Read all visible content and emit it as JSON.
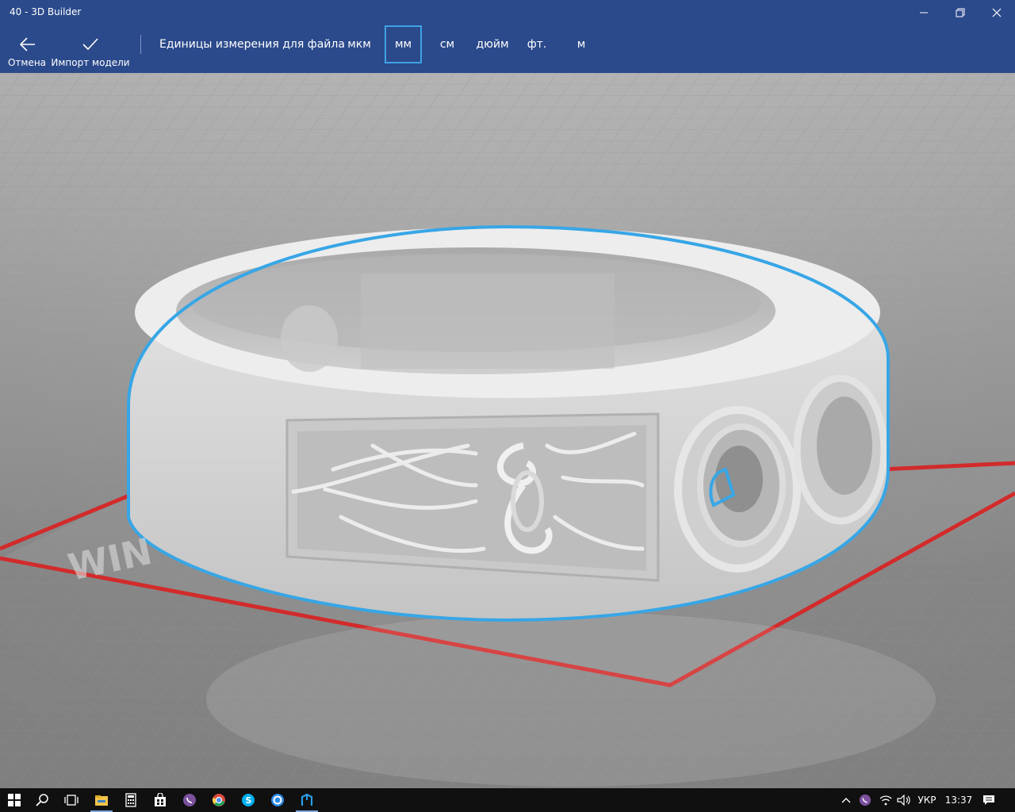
{
  "window": {
    "title": "40 - 3D Builder"
  },
  "commandbar": {
    "cancel_label": "Отмена",
    "import_label": "Импорт модели",
    "units_label": "Единицы измерения для файла",
    "units": [
      "мкм",
      "мм",
      "см",
      "дюйм",
      "фт.",
      "м"
    ],
    "selected_unit": "мм"
  },
  "viewport": {
    "selection_color": "#37a6e6",
    "plate_border_color": "#d22b2b"
  },
  "taskbar": {
    "language": "УКР",
    "time": "13:37",
    "apps": [
      "start-icon",
      "search-icon",
      "task-view-icon",
      "file-explorer-icon",
      "calculator-icon",
      "store-icon",
      "viber-icon",
      "chrome-icon",
      "skype-icon",
      "settings-app-icon",
      "3d-builder-icon"
    ]
  },
  "colors": {
    "accent": "#2b4a8b",
    "taskbar": "#101010"
  }
}
